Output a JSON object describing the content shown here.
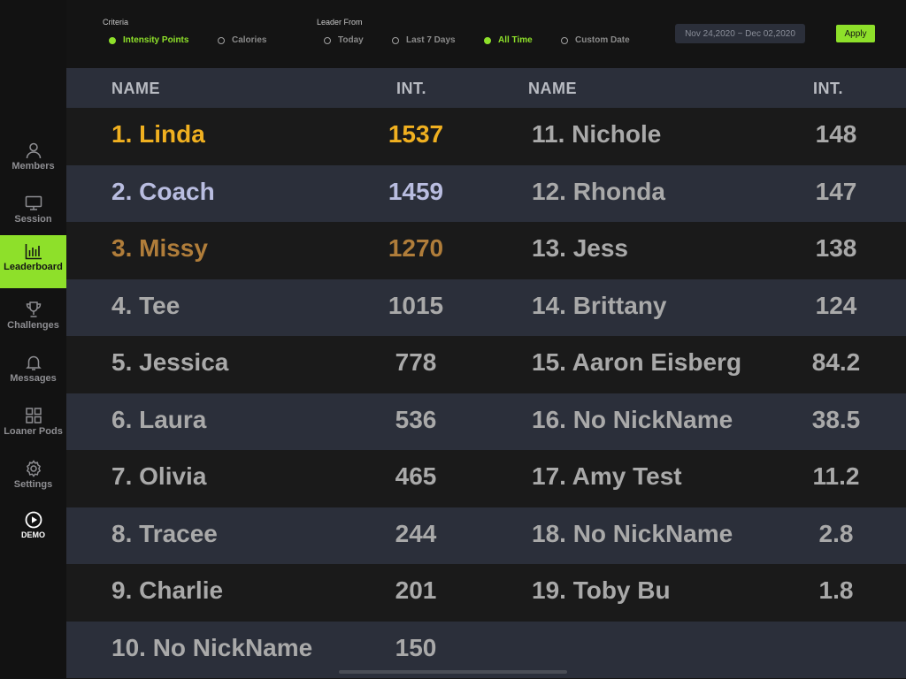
{
  "sidebar": {
    "items": [
      {
        "label": "Members",
        "icon": "person-icon",
        "active": false
      },
      {
        "label": "Session",
        "icon": "monitor-icon",
        "active": false
      },
      {
        "label": "Leaderboard",
        "icon": "bar-chart-icon",
        "active": true
      },
      {
        "label": "Challenges",
        "icon": "trophy-icon",
        "active": false
      },
      {
        "label": "Messages",
        "icon": "bell-icon",
        "active": false
      },
      {
        "label": "Loaner Pods",
        "icon": "grid-icon",
        "active": false
      },
      {
        "label": "Settings",
        "icon": "gear-icon",
        "active": false
      }
    ],
    "demo_label": "DEMO"
  },
  "filters": {
    "criteria_label": "Criteria",
    "criteria_options": [
      "Intensity Points",
      "Calories"
    ],
    "criteria_selected": "Intensity Points",
    "leader_from_label": "Leader From",
    "leader_from_options": [
      "Today",
      "Last 7 Days",
      "All Time",
      "Custom Date"
    ],
    "leader_from_selected": "All Time",
    "date_range": "Nov 24,2020 ~ Dec 02,2020",
    "apply_label": "Apply"
  },
  "table": {
    "headers": [
      "NAME",
      "INT.",
      "NAME",
      "INT."
    ],
    "left": [
      {
        "name": "1. Linda",
        "value": "1537"
      },
      {
        "name": "2. Coach",
        "value": "1459"
      },
      {
        "name": "3. Missy",
        "value": "1270"
      },
      {
        "name": "4. Tee",
        "value": "1015"
      },
      {
        "name": "5. Jessica",
        "value": "778"
      },
      {
        "name": "6. Laura",
        "value": "536"
      },
      {
        "name": "7. Olivia",
        "value": "465"
      },
      {
        "name": "8. Tracee",
        "value": "244"
      },
      {
        "name": "9. Charlie",
        "value": "201"
      },
      {
        "name": "10. No NickName",
        "value": "150"
      }
    ],
    "right": [
      {
        "name": "11. Nichole",
        "value": "148"
      },
      {
        "name": "12. Rhonda",
        "value": "147"
      },
      {
        "name": "13. Jess",
        "value": "138"
      },
      {
        "name": "14. Brittany",
        "value": "124"
      },
      {
        "name": "15. Aaron Eisberg",
        "value": "84.2"
      },
      {
        "name": "16. No NickName",
        "value": "38.5"
      },
      {
        "name": "17. Amy Test",
        "value": "11.2"
      },
      {
        "name": "18. No NickName",
        "value": "2.8"
      },
      {
        "name": "19. Toby Bu",
        "value": "1.8"
      }
    ]
  },
  "colors": {
    "accent": "#8ee02a",
    "gold": "#f0b020",
    "silver": "#b9bde0",
    "bronze": "#b07d3a"
  }
}
